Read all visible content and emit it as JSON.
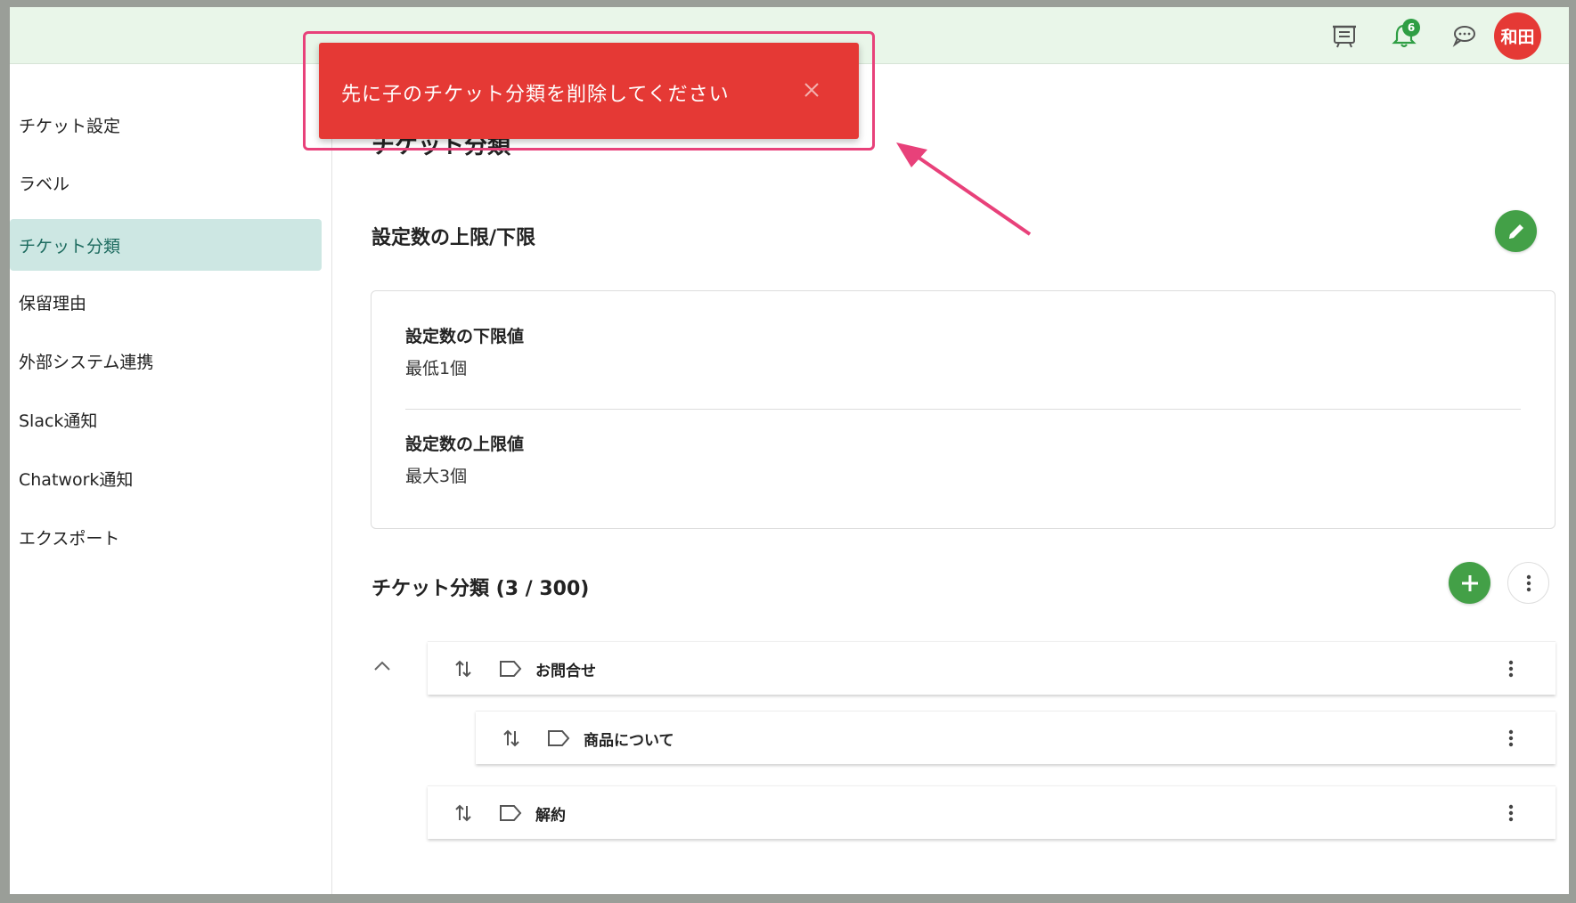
{
  "topbar": {
    "notification_count": "6",
    "user_initials": "和田",
    "icons": [
      "ticket-board-icon",
      "bell-icon",
      "chat-icon"
    ]
  },
  "sidebar": {
    "items": [
      {
        "label": "チケット設定"
      },
      {
        "label": "ラベル"
      },
      {
        "label": "チケット分類",
        "active": true
      },
      {
        "label": "保留理由"
      },
      {
        "label": "外部システム連携"
      },
      {
        "label": "Slack通知"
      },
      {
        "label": "Chatwork通知"
      },
      {
        "label": "エクスポート"
      }
    ]
  },
  "main": {
    "page_title": "チケット分類",
    "limits": {
      "title": "設定数の上限/下限",
      "min_label": "設定数の下限値",
      "min_value": "最低1個",
      "max_label": "設定数の上限値",
      "max_value": "最大3個"
    },
    "categories": {
      "title": "チケット分類 (3 / 300)",
      "rows": [
        {
          "label": "お問合せ",
          "level": 0
        },
        {
          "label": "商品について",
          "level": 1
        },
        {
          "label": "解約",
          "level": 0
        }
      ]
    }
  },
  "toast": {
    "message": "先に子のチケット分類を削除してください"
  },
  "colors": {
    "accent_green": "#43a047",
    "toast_red": "#e53935",
    "highlight_pink": "#e8417a",
    "sidebar_active": "#cde7e3"
  }
}
